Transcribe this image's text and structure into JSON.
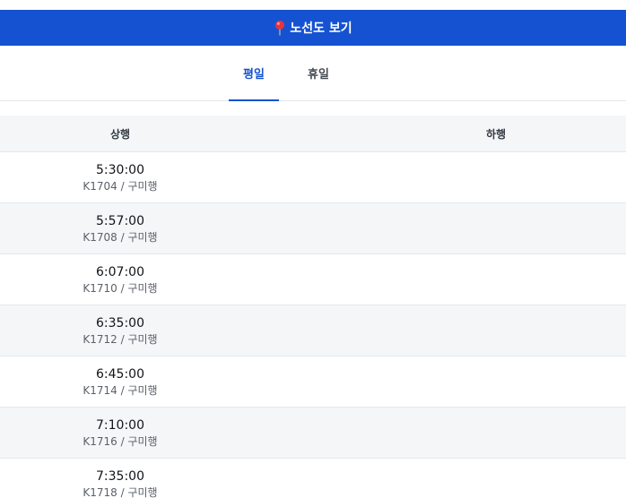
{
  "banner": {
    "label": "노선도 보기",
    "icon": "map-pin-icon",
    "color": "#1552d1"
  },
  "tabs": [
    {
      "label": "평일",
      "active": true
    },
    {
      "label": "휴일",
      "active": false
    }
  ],
  "table": {
    "headers": {
      "up": "상행",
      "down": "하행"
    },
    "rows": [
      {
        "time": "5:30:00",
        "train": "K1704 / 구미행"
      },
      {
        "time": "5:57:00",
        "train": "K1708 / 구미행"
      },
      {
        "time": "6:07:00",
        "train": "K1710 / 구미행"
      },
      {
        "time": "6:35:00",
        "train": "K1712 / 구미행"
      },
      {
        "time": "6:45:00",
        "train": "K1714 / 구미행"
      },
      {
        "time": "7:10:00",
        "train": "K1716 / 구미행"
      },
      {
        "time": "7:35:00",
        "train": "K1718 / 구미행"
      }
    ]
  }
}
